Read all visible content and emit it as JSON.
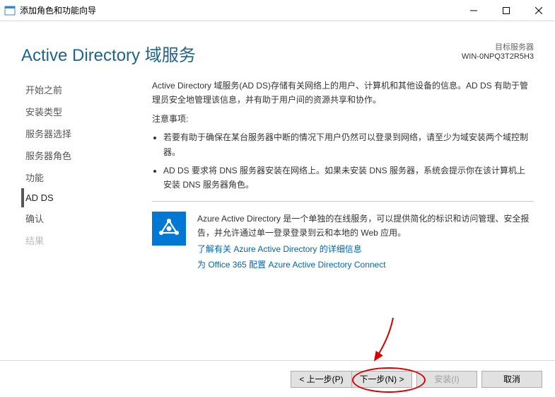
{
  "window": {
    "title": "添加角色和功能向导"
  },
  "header": {
    "page_title": "Active Directory 域服务",
    "target_label": "目标服务器",
    "target_name": "WIN-0NPQ3T2R5H3"
  },
  "sidebar": {
    "items": [
      {
        "label": "开始之前",
        "state": "normal"
      },
      {
        "label": "安装类型",
        "state": "normal"
      },
      {
        "label": "服务器选择",
        "state": "normal"
      },
      {
        "label": "服务器角色",
        "state": "normal"
      },
      {
        "label": "功能",
        "state": "normal"
      },
      {
        "label": "AD DS",
        "state": "active"
      },
      {
        "label": "确认",
        "state": "normal"
      },
      {
        "label": "结果",
        "state": "disabled"
      }
    ]
  },
  "content": {
    "intro": "Active Directory 域服务(AD DS)存储有关网络上的用户、计算机和其他设备的信息。AD DS 有助于管理员安全地管理该信息，并有助于用户间的资源共享和协作。",
    "notes_heading": "注意事项:",
    "bullets": [
      "若要有助于确保在某台服务器中断的情况下用户仍然可以登录到网络，请至少为域安装两个域控制器。",
      "AD DS 要求将 DNS 服务器安装在网络上。如果未安装 DNS 服务器，系统会提示你在该计算机上安装 DNS 服务器角色。"
    ],
    "azure_desc": "Azure Active Directory 是一个单独的在线服务，可以提供简化的标识和访问管理、安全报告，并允许通过单一登录登录到云和本地的 Web 应用。",
    "azure_link1": "了解有关 Azure Active Directory 的详细信息",
    "azure_link2": "为 Office 365 配置 Azure Active Directory Connect"
  },
  "footer": {
    "prev": "< 上一步(P)",
    "next": "下一步(N) >",
    "install": "安装(I)",
    "cancel": "取消"
  }
}
